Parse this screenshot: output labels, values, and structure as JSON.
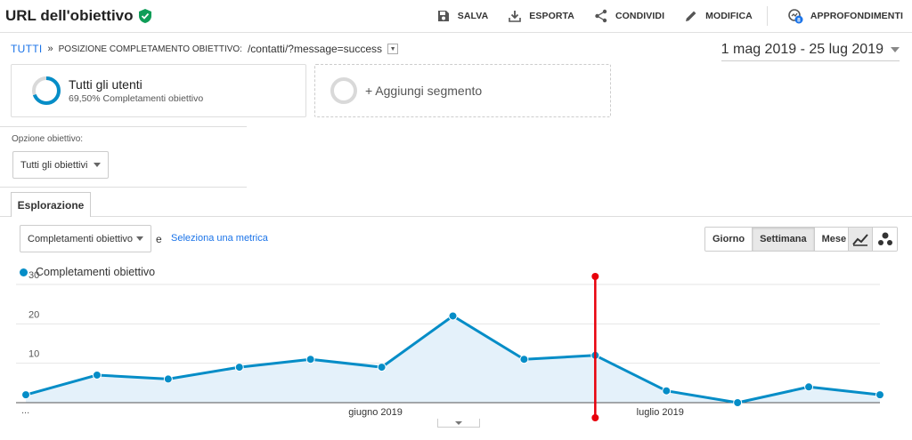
{
  "header": {
    "title": "URL dell'obiettivo",
    "actions": [
      {
        "label": "SALVA",
        "icon": "save-icon"
      },
      {
        "label": "ESPORTA",
        "icon": "download-icon"
      },
      {
        "label": "CONDIVIDI",
        "icon": "share-icon"
      },
      {
        "label": "MODIFICA",
        "icon": "pencil-icon"
      },
      {
        "label": "APPROFONDIMENTI",
        "icon": "insights-icon"
      }
    ],
    "insights_badge": "8"
  },
  "breadcrumb": {
    "root": "TUTTI",
    "separator": "»",
    "label": "POSIZIONE COMPLETAMENTO OBIETTIVO:",
    "path": "/contatti/?message=success"
  },
  "date_range": "1 mag 2019 - 25 lug 2019",
  "segments": {
    "active": {
      "name": "Tutti gli utenti",
      "sub": "69,50% Completamenti obiettivo"
    },
    "add_label": "+ Aggiungi segmento"
  },
  "goal_option": {
    "label": "Opzione obiettivo:",
    "value": "Tutti gli obiettivi"
  },
  "tabs": {
    "active": "Esplorazione"
  },
  "metric": {
    "primary": "Completamenti obiettivo",
    "conjunction": "e",
    "secondary_link": "Seleziona una metrica"
  },
  "granularity": {
    "options": [
      "Giorno",
      "Settimana",
      "Mese"
    ],
    "selected": "Settimana"
  },
  "colors": {
    "series": "#058dc7",
    "marker": "#e8000b",
    "accent": "#1a73e8",
    "verified": "#0f9d58"
  },
  "chart_data": {
    "type": "area",
    "series": [
      {
        "name": "Completamenti obiettivo",
        "values": [
          2,
          7,
          6,
          9,
          11,
          9,
          22,
          11,
          12,
          3,
          0,
          4,
          2
        ]
      }
    ],
    "x_tick_labels": [
      {
        "index": 0,
        "label": "..."
      },
      {
        "index": 5,
        "label": "giugno 2019"
      },
      {
        "index": 9,
        "label": "luglio 2019"
      }
    ],
    "y_ticks": [
      10,
      20,
      30
    ],
    "ylim": [
      0,
      30
    ],
    "grid": true,
    "marker_at_index": 8
  }
}
